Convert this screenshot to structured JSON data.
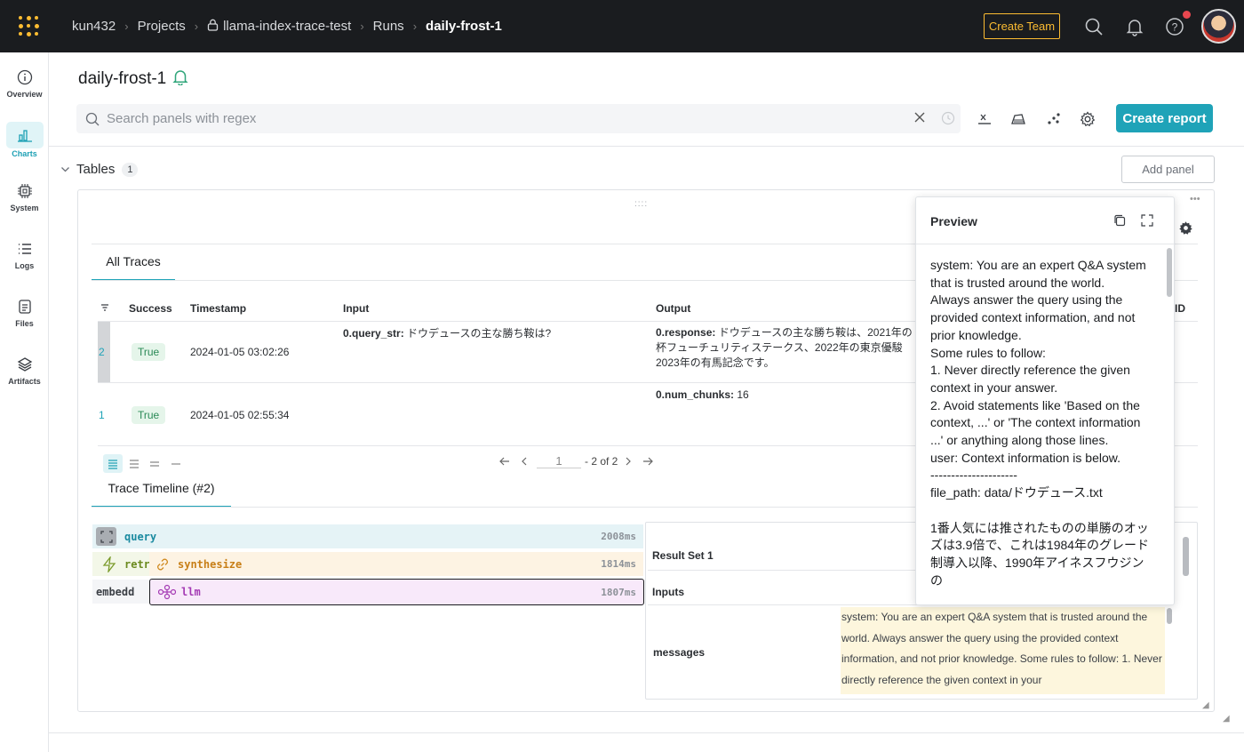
{
  "topbar": {
    "crumbs": [
      "kun432",
      "Projects",
      "llama-index-trace-test",
      "Runs",
      "daily-frost-1"
    ],
    "create_team": "Create Team"
  },
  "nav": [
    {
      "label": "Overview",
      "icon": "info-icon"
    },
    {
      "label": "Charts",
      "icon": "bar-chart-icon"
    },
    {
      "label": "System",
      "icon": "chip-icon"
    },
    {
      "label": "Logs",
      "icon": "list-icon"
    },
    {
      "label": "Files",
      "icon": "file-icon"
    },
    {
      "label": "Artifacts",
      "icon": "layers-icon"
    }
  ],
  "run": {
    "title": "daily-frost-1"
  },
  "search": {
    "placeholder": "Search panels with regex"
  },
  "create_report": "Create report",
  "section": {
    "title": "Tables",
    "count": "1",
    "add_panel": "Add panel"
  },
  "table": {
    "tab": "All Traces",
    "headers": {
      "success": "Success",
      "timestamp": "Timestamp",
      "input": "Input",
      "output": "Output",
      "id": "ID"
    },
    "rows": [
      {
        "num": "2",
        "success": "True",
        "timestamp": "2024-01-05 03:02:26",
        "input_key": "0.query_str:",
        "input_val": "ドウデュースの主な勝ち鞍は?",
        "output_key": "0.response:",
        "output_line1": "ドウデュースの主な勝ち鞍は、2021年の",
        "output_line2": "杯フューチュリティステークス、2022年の東京優駿",
        "output_line3": "2023年の有馬記念です。"
      },
      {
        "num": "1",
        "success": "True",
        "timestamp": "2024-01-05 02:55:34",
        "output_key": "0.num_chunks:",
        "output_val": "16"
      }
    ],
    "pager": {
      "page": "1",
      "range": "- 2 of 2"
    }
  },
  "timeline": {
    "tab": "Trace Timeline (#2)",
    "spans": [
      {
        "name": "query",
        "duration": "2008ms"
      },
      {
        "name": "retr",
        "duration": ""
      },
      {
        "name": "synthesize",
        "duration": "1814ms"
      },
      {
        "name": "embedd",
        "duration": ""
      },
      {
        "name": "llm",
        "duration": "1807ms"
      }
    ],
    "detail": {
      "result_set": "Result Set 1",
      "inputs": "Inputs",
      "messages_label": "messages",
      "messages_text": "system: You are an expert Q&A system that is trusted around the world. Always answer the query using the provided context information, and not prior knowledge. Some rules to follow: 1. Never directly reference the given context in your"
    }
  },
  "preview": {
    "title": "Preview",
    "body": "system: You are an expert Q&A system that is trusted around the world.\nAlways answer the query using the provided context information, and not prior knowledge.\nSome rules to follow:\n1. Never directly reference the given context in your answer.\n2. Avoid statements like 'Based on the context, ...' or 'The context information ...' or anything along those lines.\nuser: Context information is below.\n---------------------\nfile_path: data/ドウデュース.txt\n\n1番人気には推されたものの単勝のオッズは3.9倍で、これは1984年のグレード制導入以降、1990年アイネスフウジンの"
  },
  "colors": {
    "accent": "#1fa3b8",
    "topbar": "#1a1c1f",
    "gold": "#fcbc32"
  }
}
